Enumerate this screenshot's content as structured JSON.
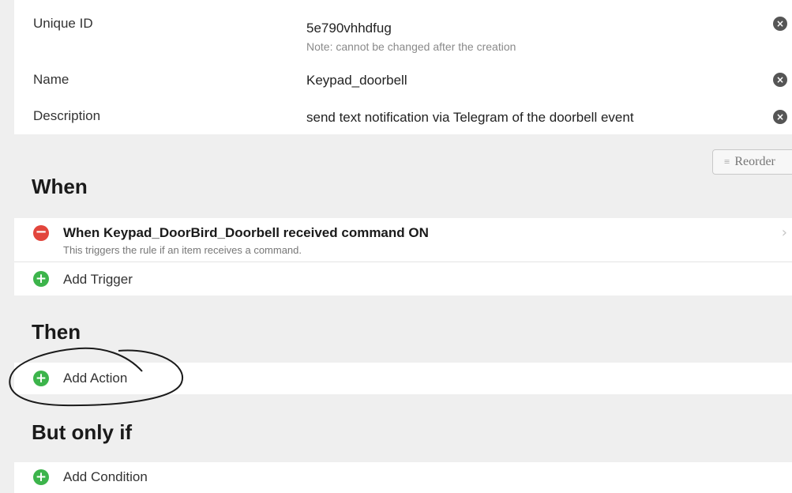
{
  "fields": [
    {
      "label": "Unique ID",
      "value": "5e790vhhdfug",
      "note": "Note: cannot be changed after the creation",
      "clear_icon": "clear-icon"
    },
    {
      "label": "Name",
      "value": "Keypad_doorbell",
      "clear_icon": "clear-icon"
    },
    {
      "label": "Description",
      "value": "send text notification via Telegram of the doorbell event",
      "clear_icon": "clear-icon"
    }
  ],
  "reorder": {
    "label": "Reorder",
    "icon": "reorder-icon"
  },
  "when": {
    "title": "When",
    "trigger": {
      "title": "When Keypad_DoorBird_Doorbell received command ON",
      "subtitle": "This triggers the rule if an item receives a command."
    },
    "add_label": "Add Trigger"
  },
  "then": {
    "title": "Then",
    "add_label": "Add Action"
  },
  "but_only_if": {
    "title": "But only if",
    "add_label": "Add Condition"
  },
  "colors": {
    "remove": "#e2453c",
    "add": "#3cb44b",
    "background": "#efefef"
  }
}
